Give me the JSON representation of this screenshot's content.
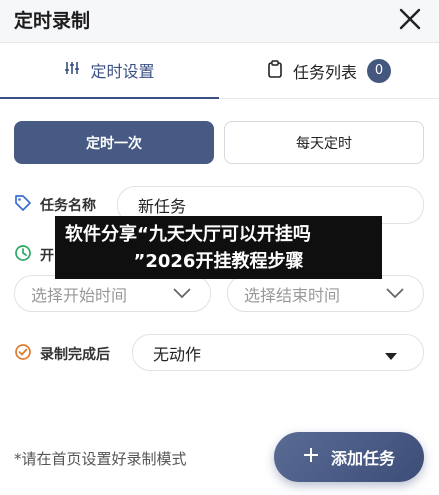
{
  "window": {
    "title": "定时录制"
  },
  "tabs": [
    {
      "label": "定时设置",
      "icon": "sliders-icon"
    },
    {
      "label": "任务列表",
      "icon": "clipboard-icon",
      "badge": "0"
    }
  ],
  "mode": {
    "once_label": "定时一次",
    "daily_label": "每天定时",
    "selected": "定时一次"
  },
  "task_name": {
    "label": "任务名称",
    "value": "新任务"
  },
  "time": {
    "label_visible": "开",
    "start_placeholder": "选择开始时间",
    "end_placeholder": "选择结束时间"
  },
  "after_record": {
    "label": "录制完成后",
    "value": "无动作"
  },
  "overlay_banner": {
    "line1": "软件分享“九天大厅可以开挂吗",
    "line2": "”2026开挂教程步骤"
  },
  "footer": {
    "hint": "*请在首页设置好录制模式",
    "add_button_label": "添加任务"
  },
  "colors": {
    "accent": "#475a84",
    "tag_blue": "#3b6fd4",
    "clock_green": "#2aa864",
    "check_orange": "#e07a2e"
  }
}
